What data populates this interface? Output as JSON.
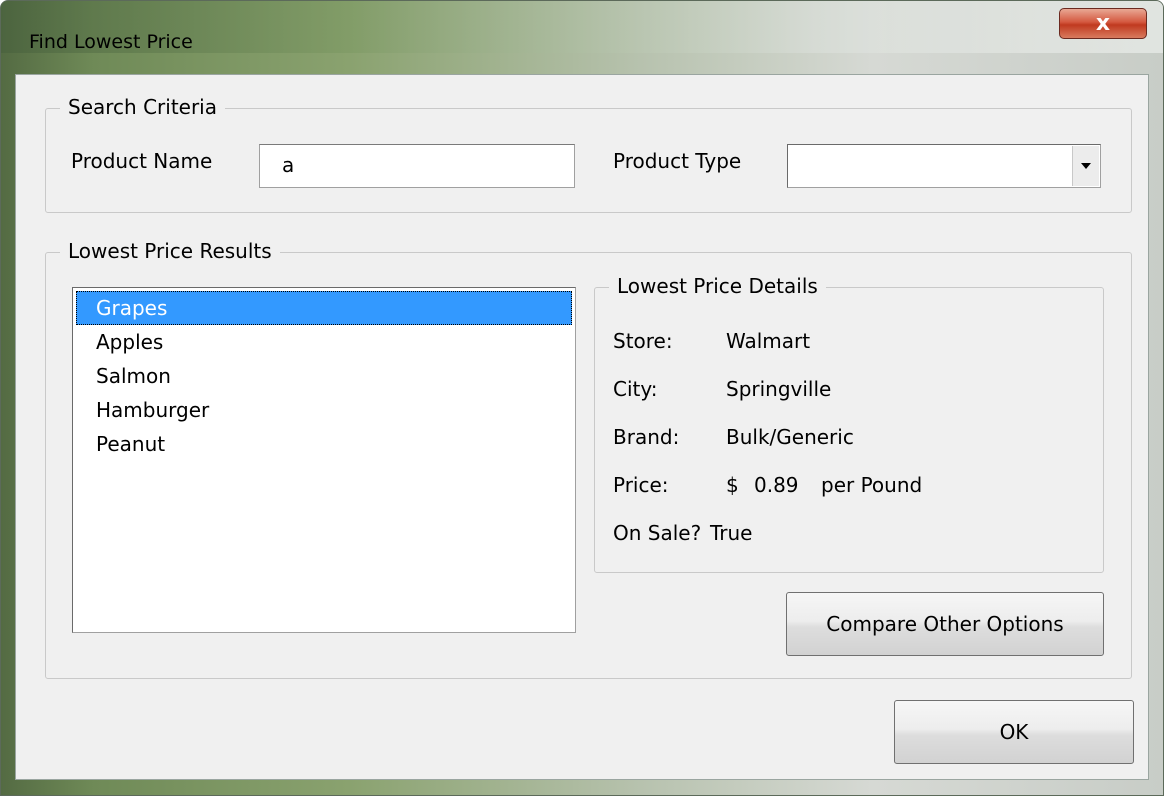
{
  "window": {
    "title": "Find Lowest Price",
    "close_label": "x"
  },
  "search": {
    "legend": "Search Criteria",
    "product_name_label": "Product Name",
    "product_name_value": "a",
    "product_type_label": "Product Type",
    "product_type_value": ""
  },
  "results": {
    "legend": "Lowest Price Results",
    "items": [
      "Grapes",
      "Apples",
      "Salmon",
      "Hamburger",
      "Peanut"
    ],
    "selected_index": 0
  },
  "details": {
    "legend": "Lowest Price Details",
    "store_label": "Store:",
    "store_value": "Walmart",
    "city_label": "City:",
    "city_value": "Springville",
    "brand_label": "Brand:",
    "brand_value": "Bulk/Generic",
    "price_label": "Price:",
    "price_currency": "$",
    "price_value": "0.89",
    "price_unit": "per Pound",
    "on_sale_label": "On Sale?",
    "on_sale_value": "True"
  },
  "buttons": {
    "compare_label": "Compare Other Options",
    "ok_label": "OK"
  },
  "colors": {
    "selection": "#3399ff",
    "close_button": "#c0391f"
  },
  "icons": {
    "close": "close-icon",
    "dropdown": "chevron-down-icon"
  }
}
